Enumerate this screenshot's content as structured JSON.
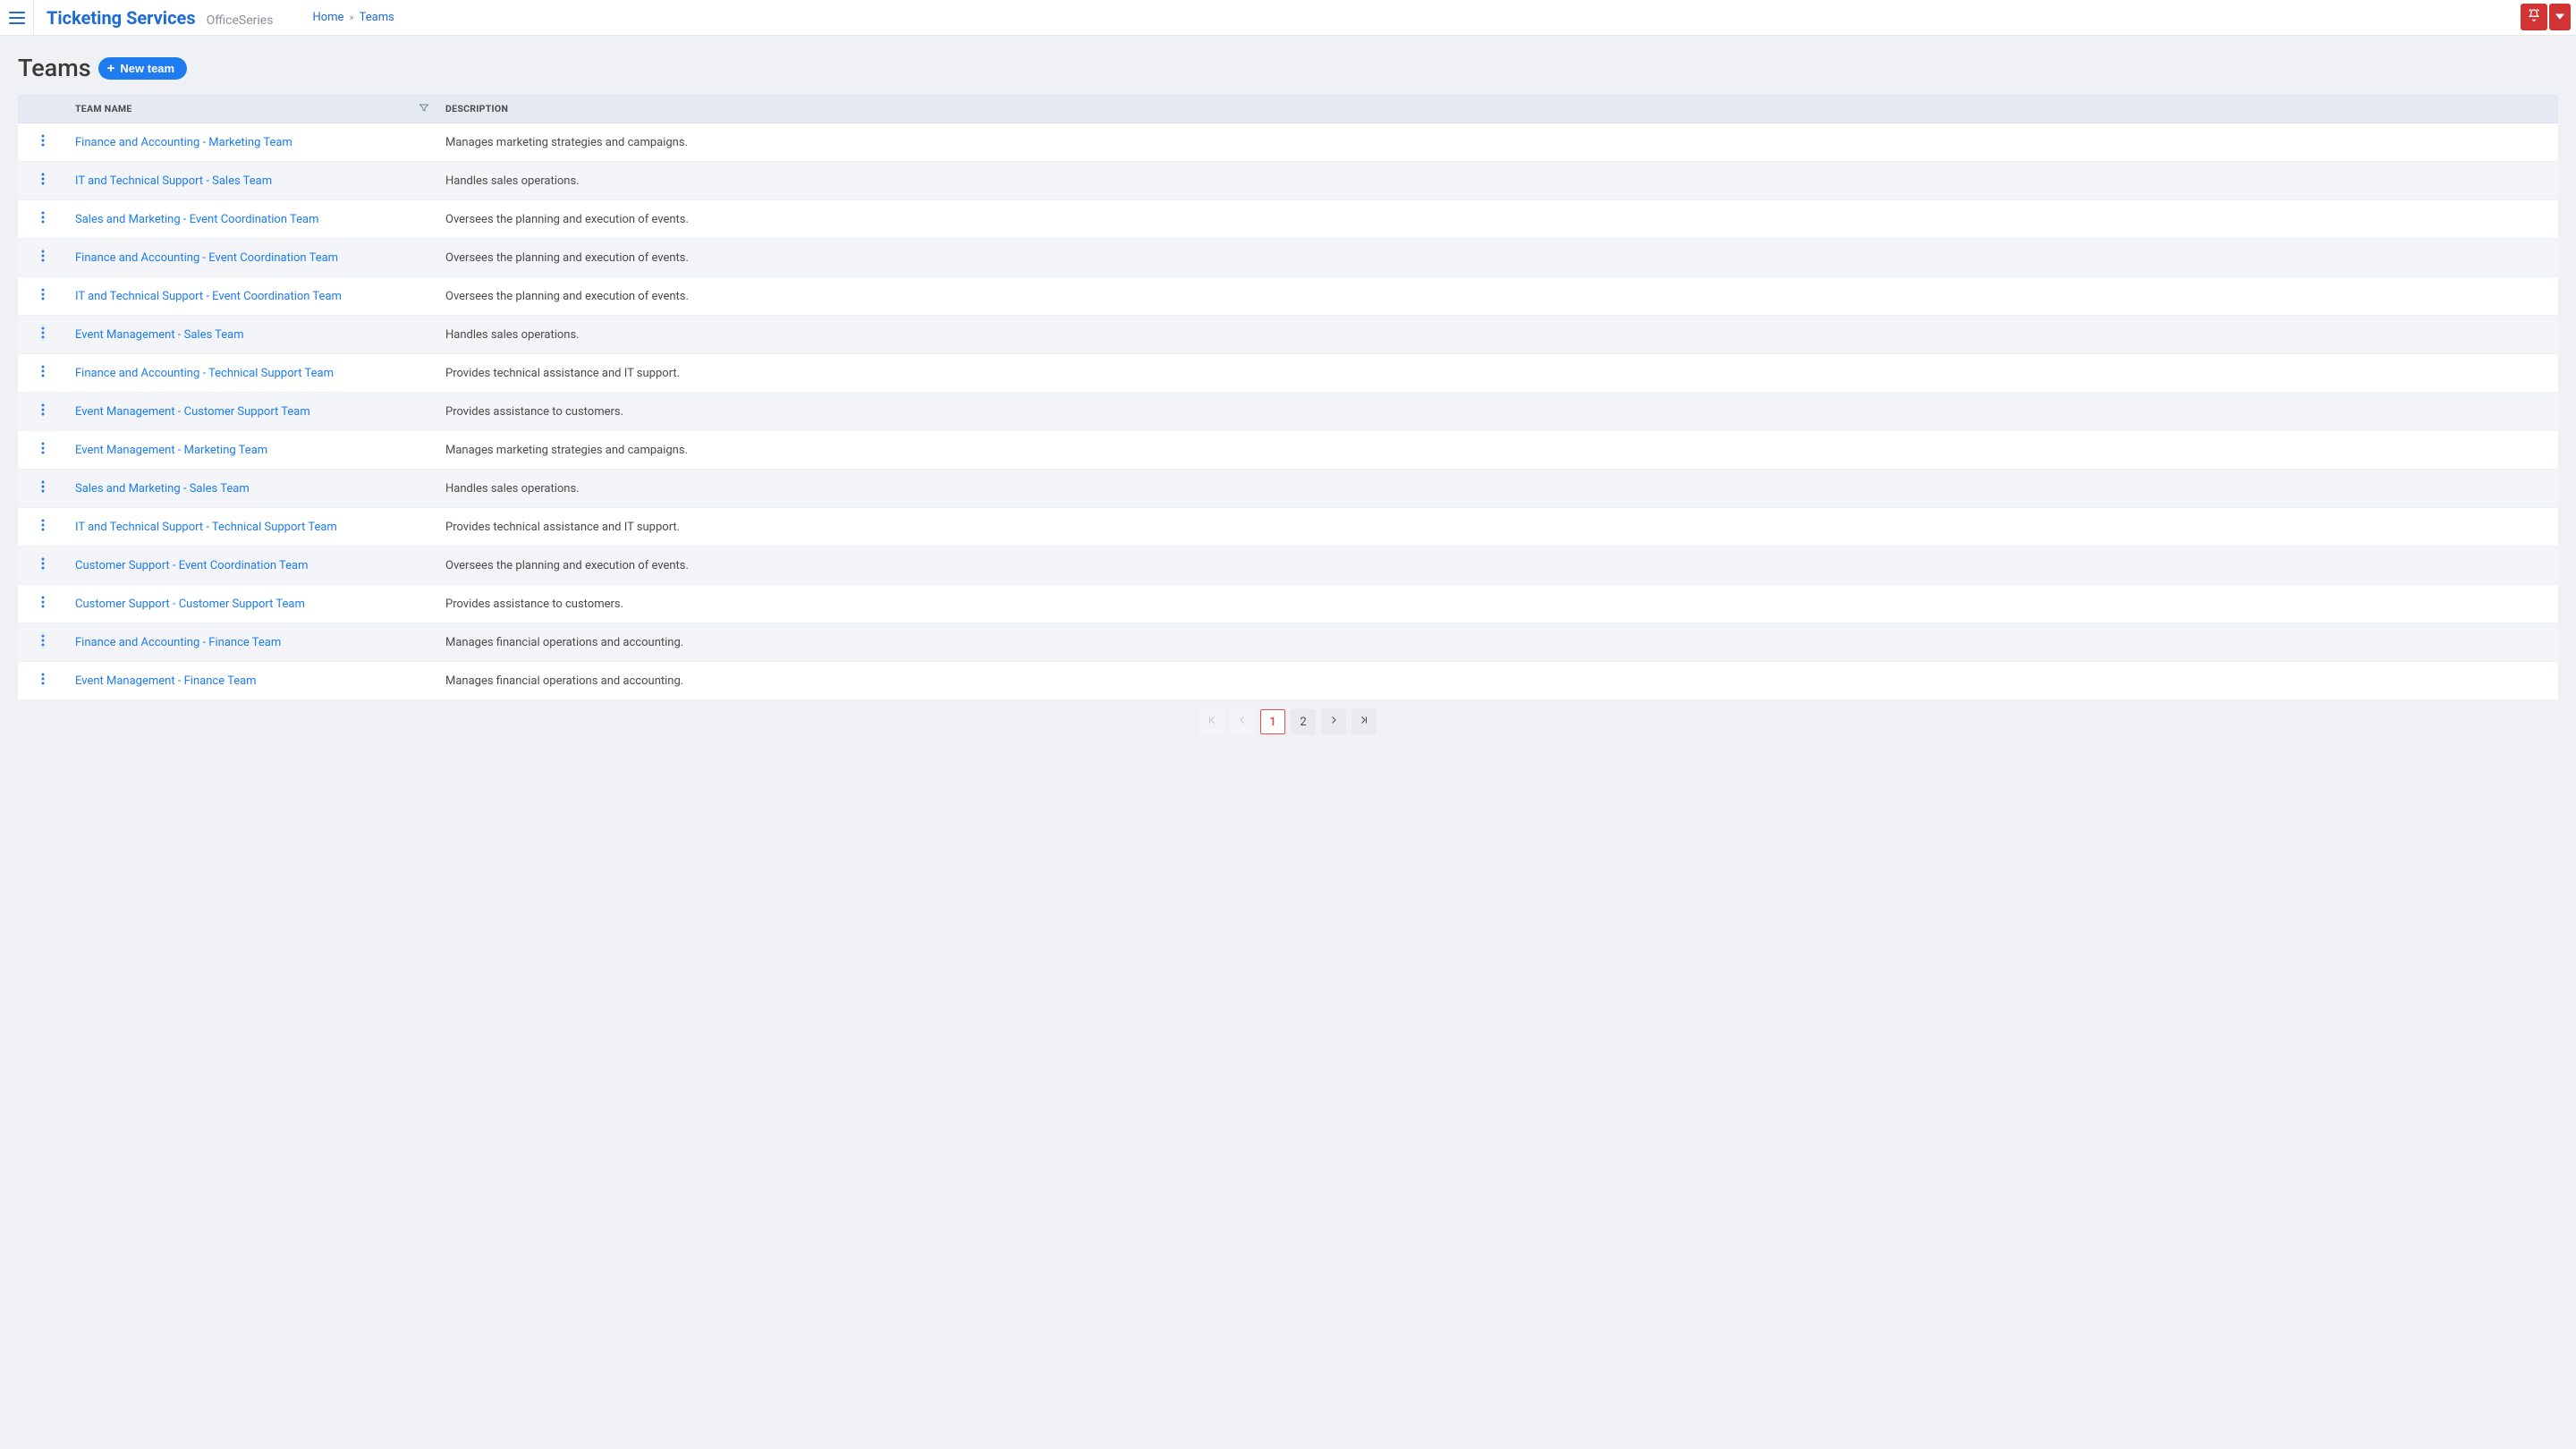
{
  "header": {
    "brand_title": "Ticketing Services",
    "brand_sub": "OfficeSeries"
  },
  "breadcrumb": {
    "home": "Home",
    "current": "Teams"
  },
  "page": {
    "title": "Teams",
    "new_button": "New team"
  },
  "table": {
    "columns": {
      "name": "TEAM NAME",
      "description": "DESCRIPTION"
    },
    "rows": [
      {
        "name": "Finance and Accounting - Marketing Team",
        "description": "Manages marketing strategies and campaigns."
      },
      {
        "name": "IT and Technical Support - Sales Team",
        "description": "Handles sales operations."
      },
      {
        "name": "Sales and Marketing - Event Coordination Team",
        "description": "Oversees the planning and execution of events."
      },
      {
        "name": "Finance and Accounting - Event Coordination Team",
        "description": "Oversees the planning and execution of events."
      },
      {
        "name": "IT and Technical Support - Event Coordination Team",
        "description": "Oversees the planning and execution of events."
      },
      {
        "name": "Event Management - Sales Team",
        "description": "Handles sales operations."
      },
      {
        "name": "Finance and Accounting - Technical Support Team",
        "description": "Provides technical assistance and IT support."
      },
      {
        "name": "Event Management - Customer Support Team",
        "description": "Provides assistance to customers."
      },
      {
        "name": "Event Management - Marketing Team",
        "description": "Manages marketing strategies and campaigns."
      },
      {
        "name": "Sales and Marketing - Sales Team",
        "description": "Handles sales operations."
      },
      {
        "name": "IT and Technical Support - Technical Support Team",
        "description": "Provides technical assistance and IT support."
      },
      {
        "name": "Customer Support - Event Coordination Team",
        "description": "Oversees the planning and execution of events."
      },
      {
        "name": "Customer Support - Customer Support Team",
        "description": "Provides assistance to customers."
      },
      {
        "name": "Finance and Accounting - Finance Team",
        "description": "Manages financial operations and accounting."
      },
      {
        "name": "Event Management - Finance Team",
        "description": "Manages financial operations and accounting."
      }
    ]
  },
  "pagination": {
    "pages": [
      "1",
      "2"
    ],
    "current": "1"
  }
}
